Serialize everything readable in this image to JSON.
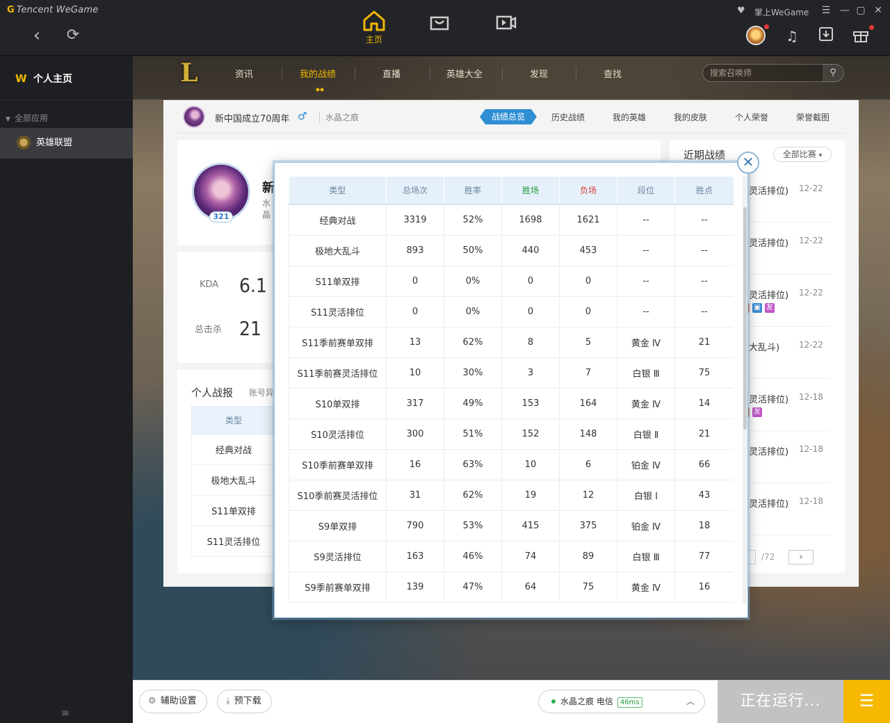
{
  "app": {
    "brand": "Tencent WeGame",
    "home_label": "主页",
    "mobile_label": "掌上WeGame"
  },
  "sidebar": {
    "home": "个人主页",
    "group": "全部应用",
    "item": "英雄联盟"
  },
  "lol_nav": {
    "tabs": [
      "资讯",
      "我的战绩",
      "直播",
      "英雄大全",
      "发现",
      "查找"
    ],
    "active_index": 1,
    "search_placeholder": "搜索召唤师"
  },
  "profile": {
    "name": "新中国成立70周年",
    "server": "水晶之痕",
    "level": "321",
    "big_name_initial": "新",
    "big_server_initial": "水晶",
    "sub_tabs": [
      "战绩总览",
      "历史战绩",
      "我的英雄",
      "我的皮肤",
      "个人荣誉",
      "荣誉截图"
    ],
    "active_sub_tab": 0,
    "kda_label": "KDA",
    "kda_value": "6.1",
    "kills_label": "总击杀",
    "kills_value": "21"
  },
  "personal_report": {
    "title": "个人战报",
    "subtitle": "账号异常",
    "header": "类型",
    "rows": [
      "经典对战",
      "极地大乱斗",
      "S11单双排",
      "S11灵活排位"
    ]
  },
  "recent": {
    "title": "近期战绩",
    "filter": "全部比赛",
    "rows": [
      {
        "mode": "灵活排位)",
        "date": "12-22",
        "tags": []
      },
      {
        "mode": "灵活排位)",
        "date": "12-22",
        "tags": []
      },
      {
        "mode": "灵活排位)",
        "date": "12-22",
        "tags": [
          "img",
          "友"
        ]
      },
      {
        "mode": "大乱斗)",
        "date": "12-22",
        "tags": []
      },
      {
        "mode": "灵活排位)",
        "date": "12-18",
        "tags": [
          "友"
        ]
      },
      {
        "mode": "灵活排位)",
        "date": "12-18",
        "tags": []
      },
      {
        "mode": "灵活排位)",
        "date": "12-18",
        "tags": []
      }
    ],
    "pager_total": "/72"
  },
  "modal": {
    "headers": [
      "类型",
      "总场次",
      "胜率",
      "胜场",
      "负场",
      "段位",
      "胜点"
    ],
    "rows": [
      [
        "经典对战",
        "3319",
        "52%",
        "1698",
        "1621",
        "--",
        "--"
      ],
      [
        "极地大乱斗",
        "893",
        "50%",
        "440",
        "453",
        "--",
        "--"
      ],
      [
        "S11单双排",
        "0",
        "0%",
        "0",
        "0",
        "--",
        "--"
      ],
      [
        "S11灵活排位",
        "0",
        "0%",
        "0",
        "0",
        "--",
        "--"
      ],
      [
        "S11季前赛单双排",
        "13",
        "62%",
        "8",
        "5",
        "黄金 Ⅳ",
        "21"
      ],
      [
        "S11季前赛灵活排位",
        "10",
        "30%",
        "3",
        "7",
        "白银 Ⅲ",
        "75"
      ],
      [
        "S10单双排",
        "317",
        "49%",
        "153",
        "164",
        "黄金 Ⅳ",
        "14"
      ],
      [
        "S10灵活排位",
        "300",
        "51%",
        "152",
        "148",
        "白银 Ⅱ",
        "21"
      ],
      [
        "S10季前赛单双排",
        "16",
        "63%",
        "10",
        "6",
        "铂金 Ⅳ",
        "66"
      ],
      [
        "S10季前赛灵活排位",
        "31",
        "62%",
        "19",
        "12",
        "白银 Ⅰ",
        "43"
      ],
      [
        "S9单双排",
        "790",
        "53%",
        "415",
        "375",
        "铂金 Ⅳ",
        "18"
      ],
      [
        "S9灵活排位",
        "163",
        "46%",
        "74",
        "89",
        "白银 Ⅲ",
        "77"
      ],
      [
        "S9季前赛单双排",
        "139",
        "47%",
        "64",
        "75",
        "黄金 Ⅳ",
        "16"
      ]
    ]
  },
  "bottom": {
    "assist_settings": "辅助设置",
    "pre_download": "预下载",
    "server": "水晶之痕 电信",
    "ping": "46ms",
    "running": "正在运行..."
  },
  "colors": {
    "accent": "#f2b705",
    "win": "#1e9b3b",
    "lose": "#d93b3b",
    "tab_active": "#2e8fd3"
  }
}
